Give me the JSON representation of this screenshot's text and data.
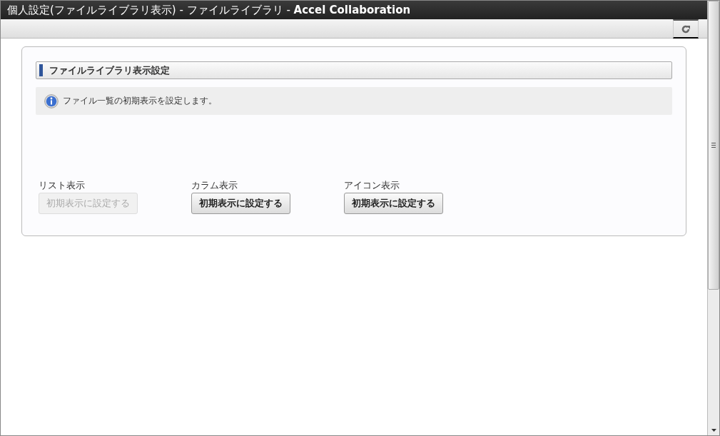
{
  "window": {
    "title": "個人設定(ファイルライブラリ表示) - ファイルライブラリ - **Accel Collaboration**"
  },
  "section": {
    "heading": "ファイルライブラリ表示設定",
    "info": "ファイル一覧の初期表示を設定します。"
  },
  "options": [
    {
      "label": "リスト表示",
      "button": "初期表示に設定する",
      "disabled": true
    },
    {
      "label": "カラム表示",
      "button": "初期表示に設定する",
      "disabled": false
    },
    {
      "label": "アイコン表示",
      "button": "初期表示に設定する",
      "disabled": false
    }
  ]
}
